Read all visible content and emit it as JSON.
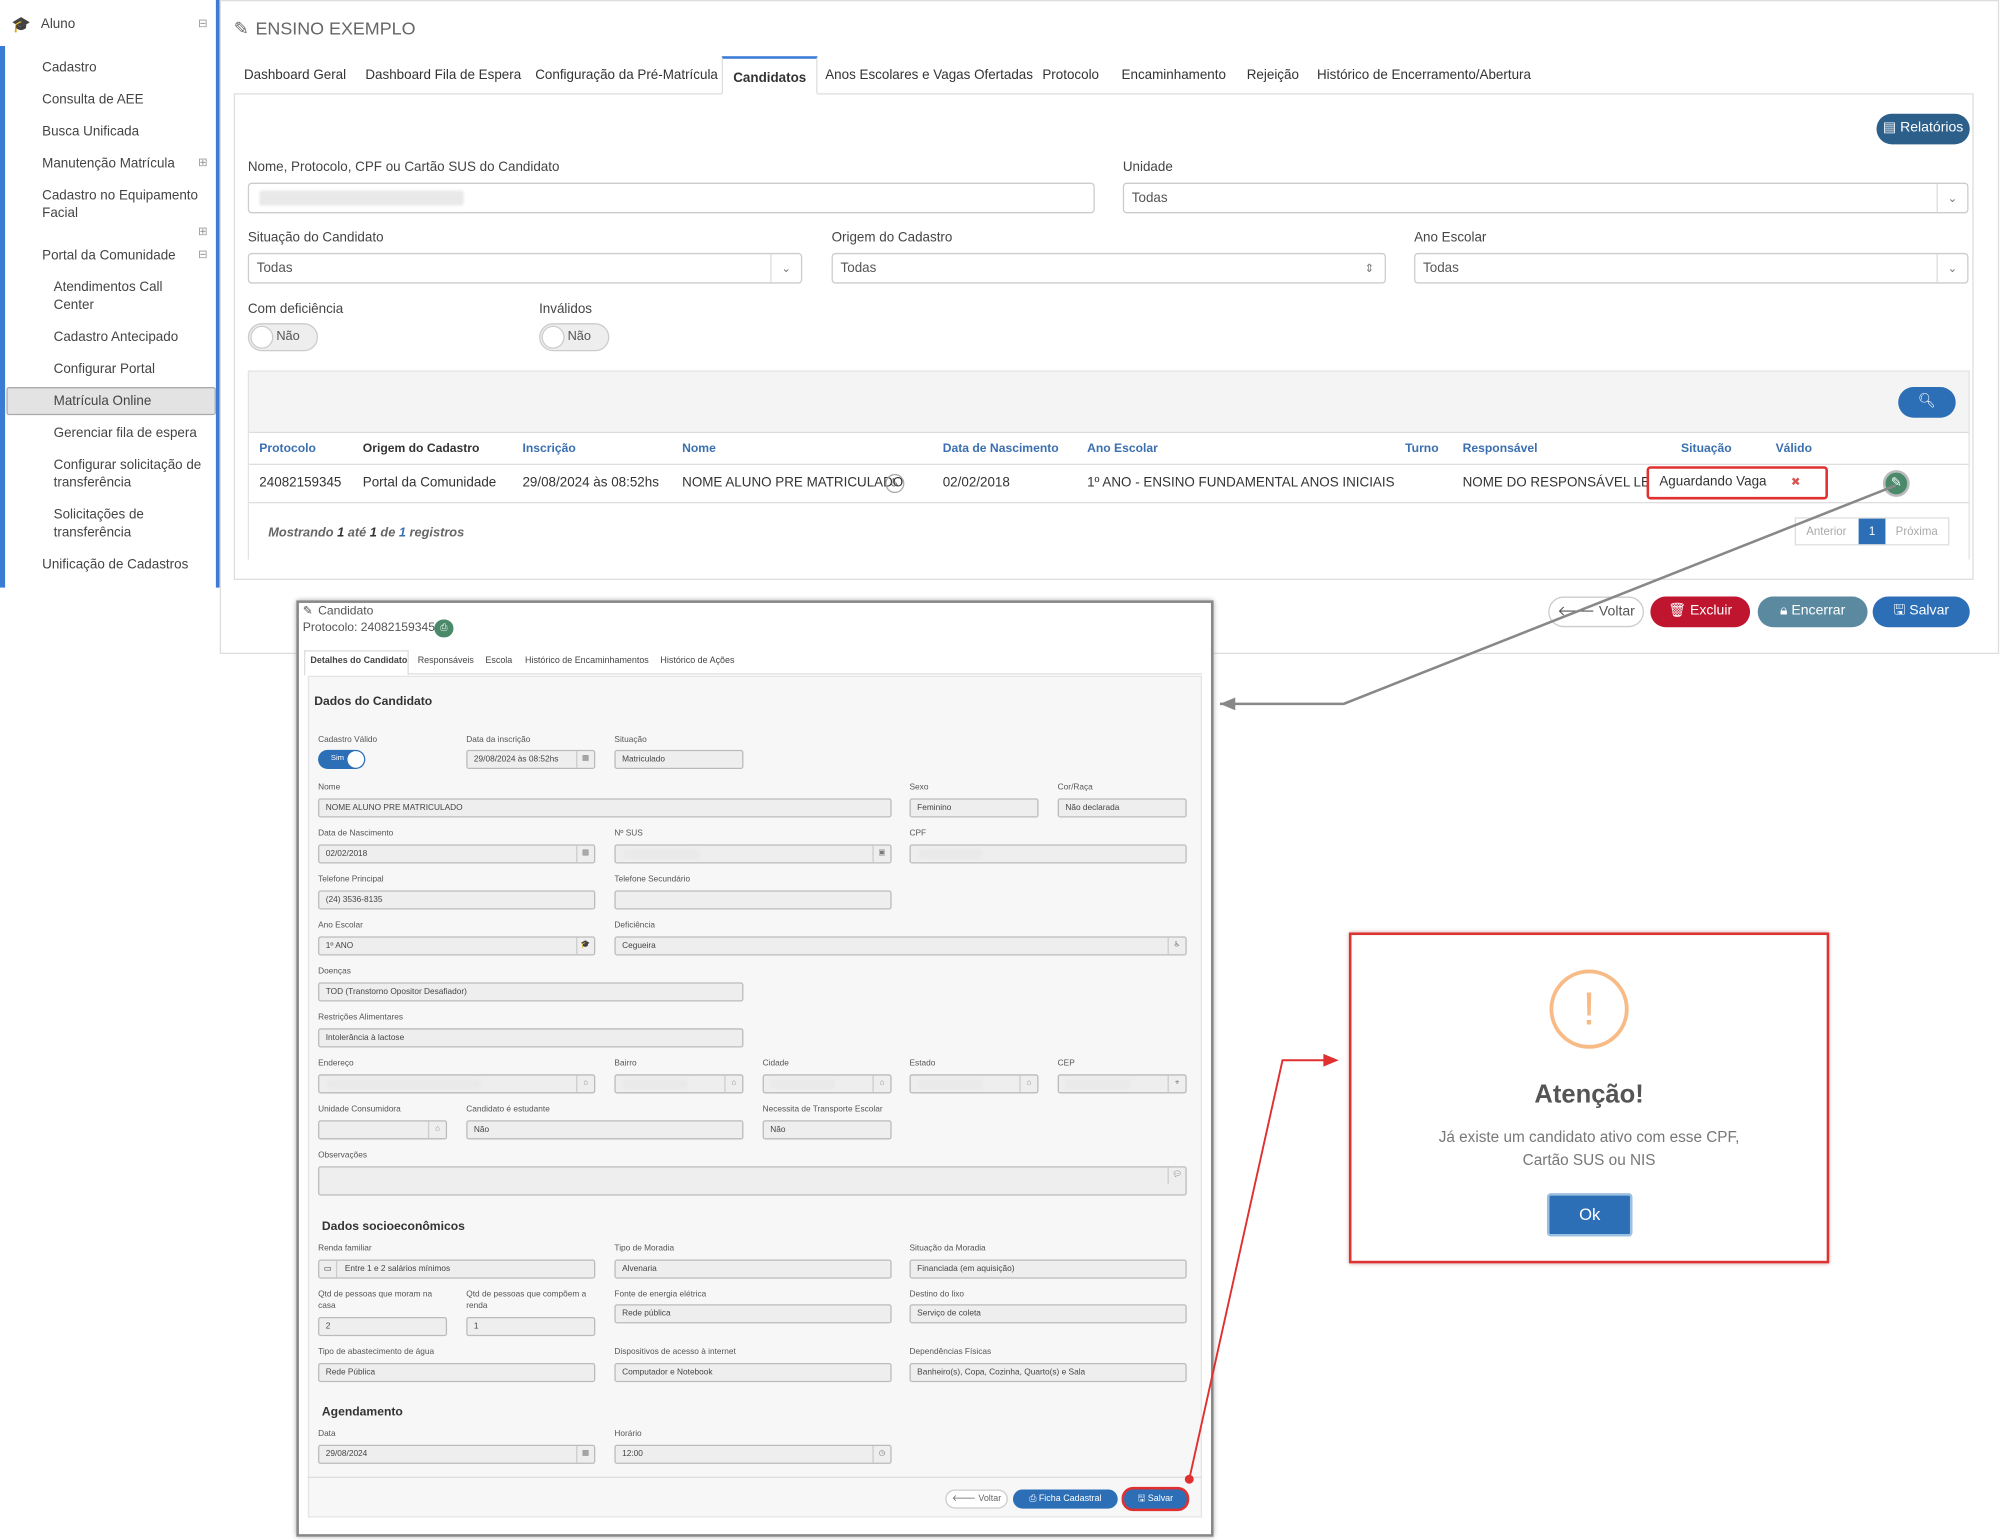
{
  "sidebar": {
    "header": "Aluno",
    "items": [
      "Cadastro",
      "Consulta de AEE",
      "Busca Unificada",
      "Manutenção Matrícula",
      "Cadastro no Equipamento",
      "Facial",
      "Portal da Comunidade",
      "Atendimentos Call",
      "Center",
      "Cadastro Antecipado",
      "Configurar Portal",
      "Matrícula Online",
      "Gerenciar fila de espera",
      "Configurar solicitação de",
      "transferência",
      "Solicitações de",
      "transferência",
      "Unificação de Cadastros"
    ]
  },
  "page": {
    "title": "ENSINO EXEMPLO"
  },
  "tabs": [
    "Dashboard Geral",
    "Dashboard Fila de Espera",
    "Configuração da Pré-Matrícula",
    "Candidatos",
    "Anos Escolares e Vagas Ofertadas",
    "Protocolo",
    "Encaminhamento",
    "Rejeição",
    "Histórico de Encerramento/Abertura"
  ],
  "filters": {
    "reports_label": "Relatórios",
    "name_label": "Nome, Protocolo, CPF ou Cartão SUS do Candidato",
    "unit_label": "Unidade",
    "unit_value": "Todas",
    "situation_label": "Situação do Candidato",
    "situation_value": "Todas",
    "origin_label": "Origem do Cadastro",
    "origin_value": "Todas",
    "year_label": "Ano Escolar",
    "year_value": "Todas",
    "disability_label": "Com deficiência",
    "disability_value": "Não",
    "invalid_label": "Inválidos",
    "invalid_value": "Não"
  },
  "table": {
    "headers": [
      "Protocolo",
      "Origem do Cadastro",
      "Inscrição",
      "Nome",
      "Data de Nascimento",
      "Ano Escolar",
      "Turno",
      "Responsável",
      "Situação",
      "Válido"
    ],
    "row": [
      "24082159345",
      "Portal da Comunidade",
      "29/08/2024 às 08:52hs",
      "NOME ALUNO PRE MATRICULADO",
      "02/02/2018",
      "1º ANO - ENSINO FUNDAMENTAL ANOS INICIAIS",
      "",
      "NOME DO RESPONSÁVEL LEGAL",
      "Aguardando Vaga",
      "✖"
    ],
    "footer_pre": "Mostrando ",
    "footer_a": "1",
    "footer_mid1": " até ",
    "footer_b": "1",
    "footer_mid2": " de ",
    "footer_c": "1",
    "footer_post": " registros",
    "prev": "Anterior",
    "page": "1",
    "next": "Próxima"
  },
  "actions": {
    "back": "Voltar",
    "delete": "Excluir",
    "close": "Encerrar",
    "save": "Salvar"
  },
  "modal": {
    "title": "Candidato",
    "protocol": "Protocolo: 24082159345",
    "tabs": [
      "Detalhes do Candidato",
      "Responsáveis",
      "Escola",
      "Histórico de Encaminhamentos",
      "Histórico de Ações"
    ],
    "section1": "Dados do Candidato",
    "labels": {
      "valid": "Cadastro Válido",
      "inscricao": "Data da inscrição",
      "situacao": "Situação",
      "nome": "Nome",
      "sexo": "Sexo",
      "cor": "Cor/Raça",
      "nasc": "Data de Nascimento",
      "sus": "Nº SUS",
      "cpf": "CPF",
      "tel1": "Telefone Principal",
      "tel2": "Telefone Secundário",
      "ano": "Ano Escolar",
      "defic": "Deficiência",
      "doencas": "Doenças",
      "restr": "Restrições Alimentares",
      "end": "Endereço",
      "bairro": "Bairro",
      "cidade": "Cidade",
      "estado": "Estado",
      "cep": "CEP",
      "uc": "Unidade Consumidora",
      "estud": "Candidato é estudante",
      "transp": "Necessita de Transporte Escolar",
      "obs": "Observações"
    },
    "values": {
      "valid": "Sim",
      "inscricao": "29/08/2024 às 08:52hs",
      "situacao": "Matriculado",
      "nome": "NOME ALUNO PRE MATRICULADO",
      "sexo": "Feminino",
      "cor": "Não declarada",
      "nasc": "02/02/2018",
      "tel1": "(24) 3536-8135",
      "ano": "1º ANO",
      "defic": "Cegueira",
      "doencas": "TOD (Transtorno Opositor Desafiador)",
      "restr": "Intolerância à lactose",
      "estud": "Não",
      "transp": "Não"
    },
    "section2": "Dados socioeconômicos",
    "labels2": {
      "renda": "Renda familiar",
      "moradia": "Tipo de Moradia",
      "sitmor": "Situação da Moradia",
      "qtdmoram": "Qtd de pessoas que moram na",
      "qtdmoram2": "casa",
      "qtdrenda": "Qtd de pessoas que compõem a",
      "qtdrenda2": "renda",
      "energia": "Fonte de energia elétrica",
      "lixo": "Destino do lixo",
      "agua": "Tipo de abastecimento de água",
      "internet": "Dispositivos de acesso à internet",
      "depend": "Dependências Físicas"
    },
    "values2": {
      "renda": "Entre 1 e 2 salários mínimos",
      "moradia": "Alvenaria",
      "sitmor": "Financiada (em aquisição)",
      "qtdmoram": "2",
      "qtdrenda": "1",
      "energia": "Rede pública",
      "lixo": "Serviço de coleta",
      "agua": "Rede Pública",
      "internet": "Computador e Notebook",
      "depend": "Banheiro(s), Copa, Cozinha, Quarto(s) e Sala"
    },
    "section3": "Agendamento",
    "labels3": {
      "data": "Data",
      "horario": "Horário"
    },
    "values3": {
      "data": "29/08/2024",
      "horario": "12:00"
    },
    "buttons": {
      "back": "Voltar",
      "ficha": "Ficha Cadastral",
      "save": "Salvar"
    }
  },
  "alert": {
    "icon": "!",
    "title": "Atenção!",
    "message1": "Já existe um candidato ativo com esse CPF,",
    "message2": "Cartão SUS ou NIS",
    "ok": "Ok"
  },
  "colors": {
    "accent": "#3a7bd5",
    "primary": "#2c6fb7",
    "danger": "#c0152f",
    "muted": "#5b8aa0",
    "warning": "#f8bb86",
    "highlight": "#e03030"
  }
}
